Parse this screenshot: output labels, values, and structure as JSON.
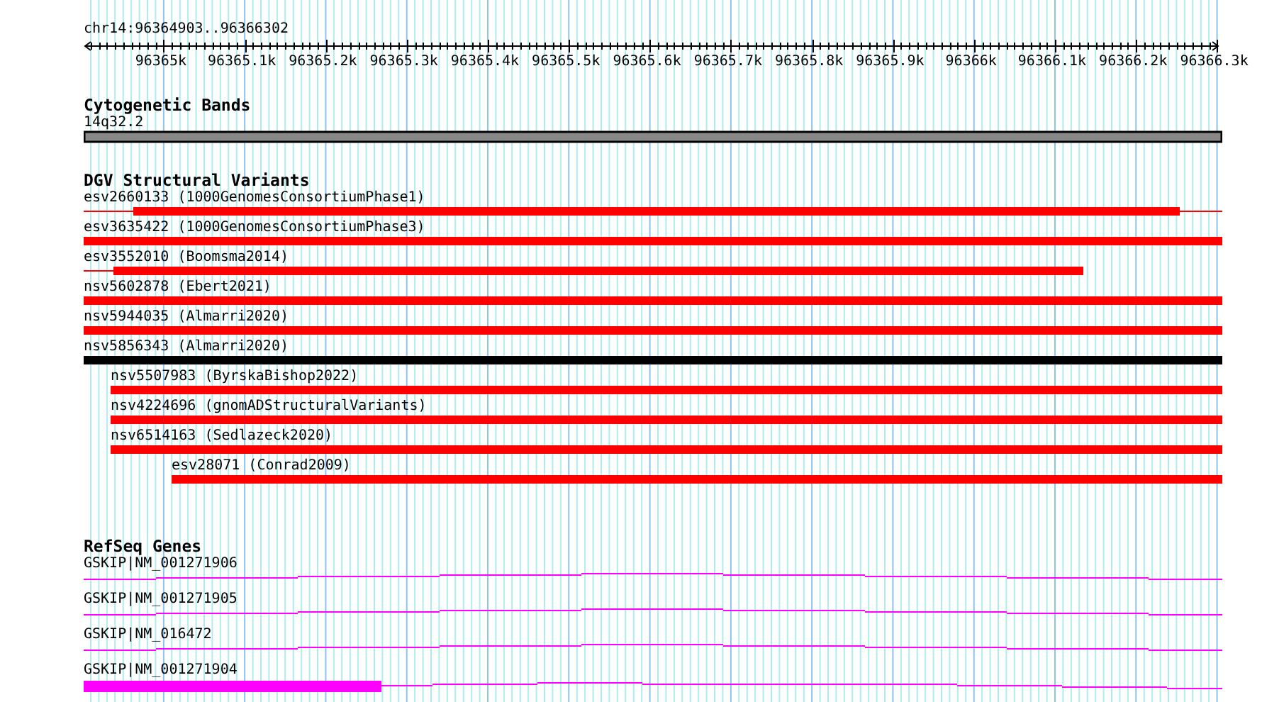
{
  "location": "chr14:96364903..96366302",
  "ruler": {
    "ticks": [
      "96365k",
      "96365.1k",
      "96365.2k",
      "96365.3k",
      "96365.4k",
      "96365.5k",
      "96365.6k",
      "96365.7k",
      "96365.8k",
      "96365.9k",
      "96366k",
      "96366.1k",
      "96366.2k",
      "96366.3k"
    ]
  },
  "tracks": [
    {
      "kind": "cytoband",
      "title": "Cytogenetic Bands",
      "features": [
        {
          "label": "14q32.2"
        }
      ]
    },
    {
      "kind": "variants",
      "title": "DGV Structural Variants",
      "features": [
        {
          "label": "esv2660133 (1000GenomesConsortiumPhase1)",
          "color": "#ff0000"
        },
        {
          "label": "esv3635422 (1000GenomesConsortiumPhase3)",
          "color": "#ff0000"
        },
        {
          "label": "esv3552010 (Boomsma2014)",
          "color": "#ff0000"
        },
        {
          "label": "nsv5602878 (Ebert2021)",
          "color": "#ff0000"
        },
        {
          "label": "nsv5944035 (Almarri2020)",
          "color": "#ff0000"
        },
        {
          "label": "nsv5856343 (Almarri2020)",
          "color": "#000000"
        },
        {
          "label": "nsv5507983 (ByrskaBishop2022)",
          "color": "#ff0000"
        },
        {
          "label": "nsv4224696 (gnomADStructuralVariants)",
          "color": "#ff0000"
        },
        {
          "label": "nsv6514163 (Sedlazeck2020)",
          "color": "#ff0000"
        },
        {
          "label": "esv28071 (Conrad2009)",
          "color": "#ff0000"
        }
      ]
    },
    {
      "kind": "genes",
      "title": "RefSeq Genes",
      "features": [
        {
          "label": "GSKIP|NM_001271906"
        },
        {
          "label": "GSKIP|NM_001271905"
        },
        {
          "label": "GSKIP|NM_016472"
        },
        {
          "label": "GSKIP|NM_001271904"
        }
      ]
    }
  ]
}
